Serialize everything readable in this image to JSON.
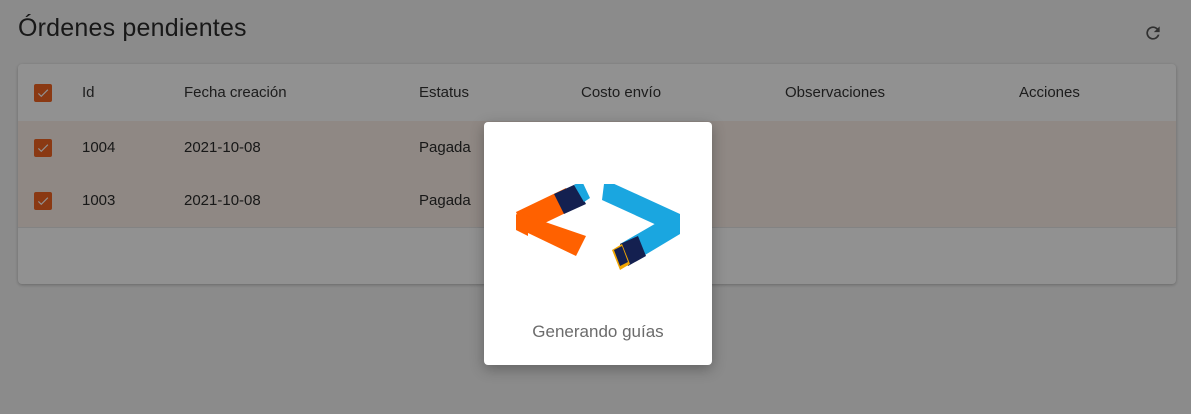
{
  "page": {
    "title": "Órdenes pendientes",
    "refresh_icon": "refresh-icon"
  },
  "table": {
    "columns": [
      "Id",
      "Fecha creación",
      "Estatus",
      "Costo envío",
      "Observaciones",
      "Acciones"
    ],
    "rows": [
      {
        "id": "1004",
        "fecha": "2021-10-08",
        "estatus": "Pagada",
        "checked": true
      },
      {
        "id": "1003",
        "fecha": "2021-10-08",
        "estatus": "Pagada",
        "checked": true
      }
    ],
    "select_all_checked": true
  },
  "modal": {
    "message": "Generando guías",
    "logo_icon": "code-brackets-logo"
  },
  "colors": {
    "accent": "#f26522",
    "brand_orange": "#ff6100",
    "brand_blue": "#1aa6e0",
    "brand_navy": "#142050",
    "overlay": "rgba(0,0,0,0.43)"
  }
}
